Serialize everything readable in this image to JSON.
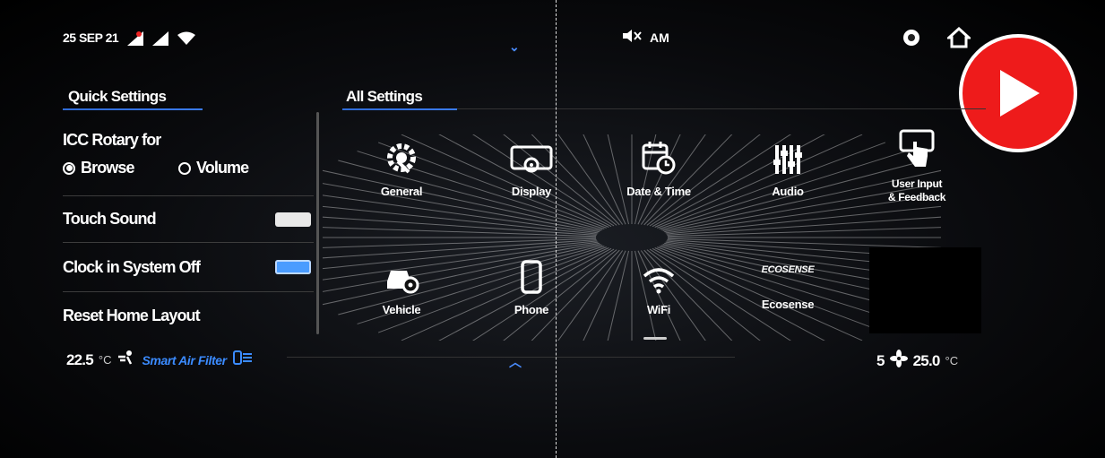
{
  "status_bar": {
    "date": "25 SEP 21",
    "audio_source": "AM"
  },
  "quick_settings": {
    "title": "Quick Settings",
    "rotary_label": "ICC Rotary for",
    "rotary_options": [
      {
        "label": "Browse",
        "selected": true
      },
      {
        "label": "Volume",
        "selected": false
      }
    ],
    "touch_sound": {
      "label": "Touch Sound",
      "on": false
    },
    "clock_off": {
      "label": "Clock in System Off",
      "on": true
    },
    "reset_label": "Reset Home Layout"
  },
  "all_settings": {
    "title": "All Settings",
    "tiles": [
      {
        "label": "General",
        "icon": "gear-wrench-icon"
      },
      {
        "label": "Display",
        "icon": "display-gear-icon"
      },
      {
        "label": "Date & Time",
        "icon": "calendar-clock-icon"
      },
      {
        "label": "Audio",
        "icon": "equalizer-icon"
      },
      {
        "label": "User Input\n& Feedback",
        "icon": "touch-hand-icon"
      },
      {
        "label": "Vehicle",
        "icon": "car-gear-icon"
      },
      {
        "label": "Phone",
        "icon": "phone-icon"
      },
      {
        "label": "WiFi",
        "icon": "wifi-icon"
      },
      {
        "label": "Ecosense",
        "icon": "ecosense-logo",
        "logo_text": "ECOSENSE"
      }
    ]
  },
  "climate_left": {
    "temp": "22.5",
    "unit": "°C",
    "smart_filter": "Smart Air Filter"
  },
  "climate_right": {
    "fan": "5",
    "temp": "25.0",
    "unit": "°C"
  },
  "colors": {
    "accent": "#3b8bff",
    "toggle_on": "#4a9cff",
    "youtube_red": "#ee1b1b"
  }
}
